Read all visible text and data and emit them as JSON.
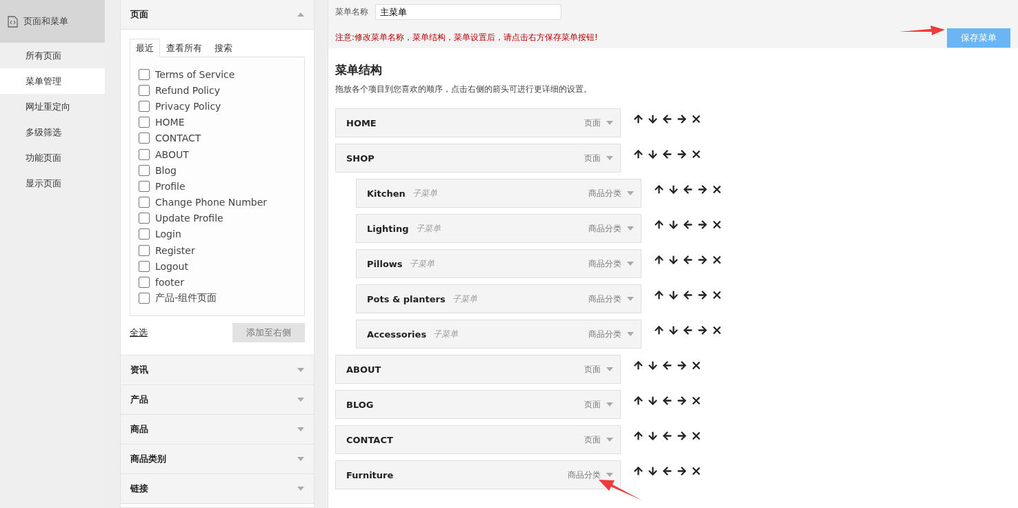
{
  "sidebar": {
    "header": {
      "label": "页面和菜单"
    },
    "items": [
      {
        "label": "所有页面",
        "selected": false
      },
      {
        "label": "菜单管理",
        "selected": true
      },
      {
        "label": "网址重定向",
        "selected": false
      },
      {
        "label": "多级筛选",
        "selected": false
      },
      {
        "label": "功能页面",
        "selected": false
      },
      {
        "label": "显示页面",
        "selected": false
      }
    ]
  },
  "panels": [
    {
      "title": "页面",
      "expanded": true
    },
    {
      "title": "资讯",
      "expanded": false
    },
    {
      "title": "产品",
      "expanded": false
    },
    {
      "title": "商品",
      "expanded": false
    },
    {
      "title": "商品类别",
      "expanded": false
    },
    {
      "title": "链接",
      "expanded": false
    }
  ],
  "page_tabs": [
    {
      "label": "最近",
      "selected": true
    },
    {
      "label": "查看所有",
      "selected": false
    },
    {
      "label": "搜索",
      "selected": false
    }
  ],
  "pages": [
    {
      "label": "Terms of Service",
      "checked": false
    },
    {
      "label": "Refund Policy",
      "checked": false
    },
    {
      "label": "Privacy Policy",
      "checked": false
    },
    {
      "label": "HOME",
      "checked": false
    },
    {
      "label": "CONTACT",
      "checked": false
    },
    {
      "label": "ABOUT",
      "checked": false
    },
    {
      "label": "Blog",
      "checked": false
    },
    {
      "label": "Profile",
      "checked": false
    },
    {
      "label": "Change Phone Number",
      "checked": false
    },
    {
      "label": "Update Profile",
      "checked": false
    },
    {
      "label": "Login",
      "checked": false
    },
    {
      "label": "Register",
      "checked": false
    },
    {
      "label": "Logout",
      "checked": false
    },
    {
      "label": "footer",
      "checked": false
    },
    {
      "label": "产品-组件页面",
      "checked": false
    }
  ],
  "select_all": "全选",
  "add_button": "添加至右侧",
  "menu_name": {
    "label": "菜单名称",
    "value": "主菜单"
  },
  "notice": "注意:修改菜单名称，菜单结构，菜单设置后，请点击右方保存菜单按钮!",
  "save_button": "保存菜单",
  "structure": {
    "title": "菜单结构",
    "description": "拖放各个项目到您喜欢的顺序，点击右侧的箭头可进行更详细的设置。"
  },
  "menu_items": [
    {
      "title": "HOME",
      "type": "页面"
    },
    {
      "title": "SHOP",
      "type": "页面",
      "children": [
        {
          "title": "Kitchen",
          "subtitle": "子菜单",
          "type": "商品分类"
        },
        {
          "title": "Lighting",
          "subtitle": "子菜单",
          "type": "商品分类"
        },
        {
          "title": "Pillows",
          "subtitle": "子菜单",
          "type": "商品分类"
        },
        {
          "title": "Pots & planters",
          "subtitle": "子菜单",
          "type": "商品分类"
        },
        {
          "title": "Accessories",
          "subtitle": "子菜单",
          "type": "商品分类"
        }
      ]
    },
    {
      "title": "ABOUT",
      "type": "页面"
    },
    {
      "title": "BLOG",
      "type": "页面"
    },
    {
      "title": "CONTACT",
      "type": "页面"
    },
    {
      "title": "Furniture",
      "type": "商品分类"
    }
  ]
}
